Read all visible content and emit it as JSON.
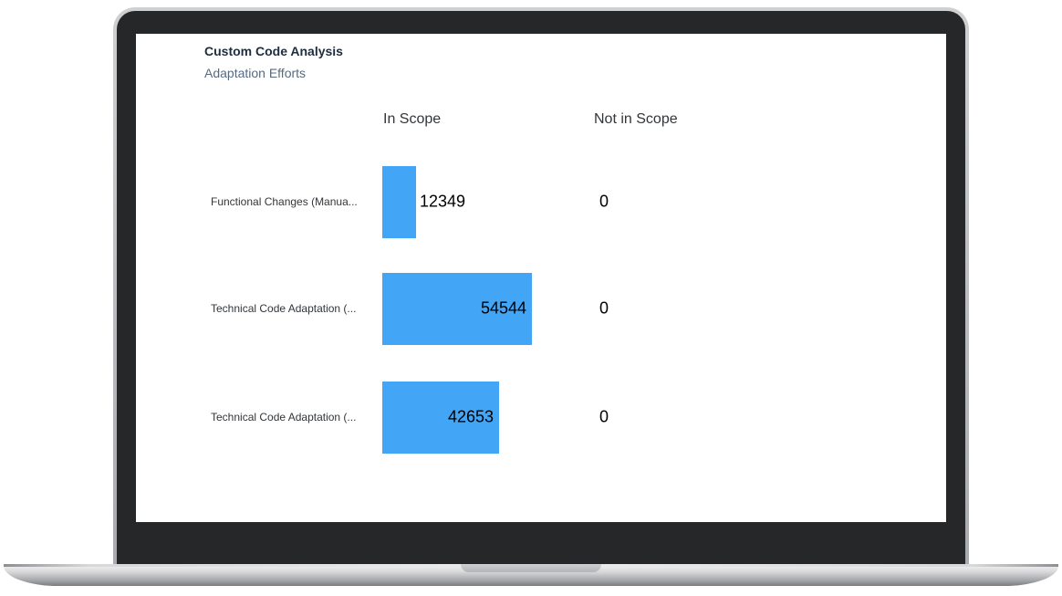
{
  "card": {
    "title": "Custom Code Analysis",
    "subtitle": "Adaptation Efforts"
  },
  "columns": {
    "in_scope": "In Scope",
    "not_in_scope": "Not in Scope"
  },
  "colors": {
    "bar": "#42a5f5"
  },
  "chart_data": {
    "type": "bar",
    "categories": [
      "Functional Changes (Manua...",
      "Technical Code Adaptation (...",
      "Technical Code Adaptation (..."
    ],
    "series": [
      {
        "name": "In Scope",
        "values": [
          12349,
          54544,
          42653
        ]
      },
      {
        "name": "Not in Scope",
        "values": [
          0,
          0,
          0
        ]
      }
    ],
    "max_value": 54544
  }
}
